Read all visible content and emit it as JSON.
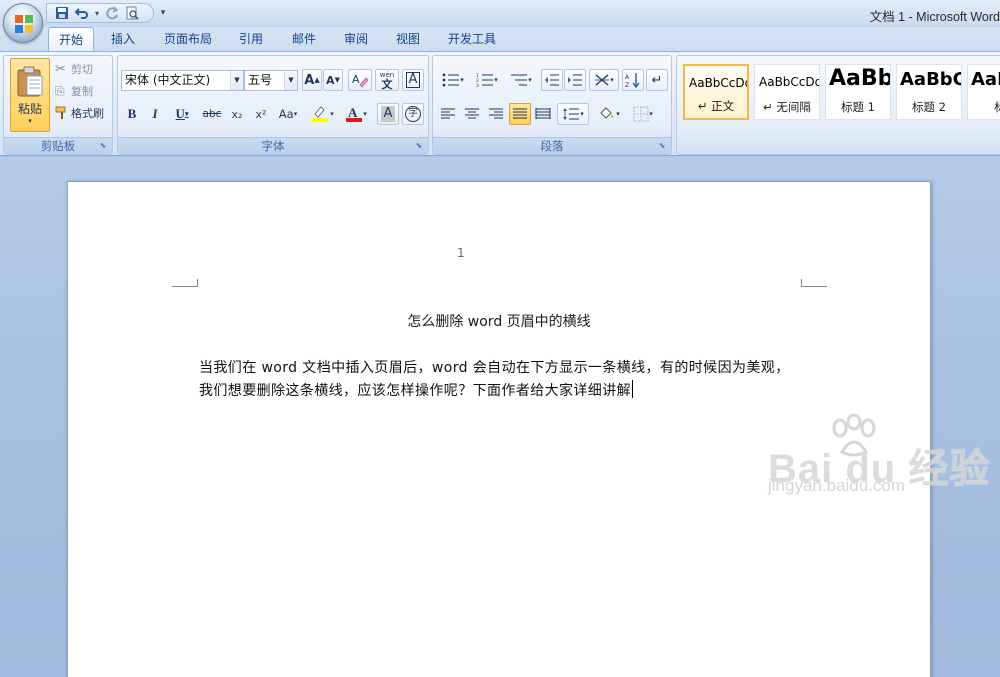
{
  "window": {
    "title": "文档 1 - Microsoft Word"
  },
  "qat": {
    "more": "▾"
  },
  "tabs": [
    {
      "label": "开始"
    },
    {
      "label": "插入"
    },
    {
      "label": "页面布局"
    },
    {
      "label": "引用"
    },
    {
      "label": "邮件"
    },
    {
      "label": "审阅"
    },
    {
      "label": "视图"
    },
    {
      "label": "开发工具"
    }
  ],
  "clipboard": {
    "label": "剪贴板",
    "paste": "粘贴",
    "cut": "剪切",
    "copy": "复制",
    "format_painter": "格式刷"
  },
  "font": {
    "label": "字体",
    "family": "宋体 (中文正文)",
    "size": "五号",
    "bold": "B",
    "italic": "I",
    "underline": "U",
    "strike": "abc",
    "subscript": "x₂",
    "superscript": "x²",
    "case": "Aa",
    "grow": "A",
    "shrink": "A",
    "clear": "A",
    "phonetic": "wén",
    "border_char": "A",
    "enclose": "字",
    "highlight_color": "#ffff00",
    "font_color": "#e01818"
  },
  "paragraph": {
    "label": "段落"
  },
  "styles": {
    "items": [
      {
        "sample": "AaBbCcDd",
        "name": "↵ 正文"
      },
      {
        "sample": "AaBbCcDd",
        "name": "↵ 无间隔"
      },
      {
        "sample": "AaBb",
        "name": "标题 1"
      },
      {
        "sample": "AaBbC",
        "name": "标题 2"
      },
      {
        "sample": "AaE",
        "name": "标"
      }
    ]
  },
  "document": {
    "page_number": "1",
    "title": "怎么删除 word 页眉中的横线",
    "body_line1": "当我们在 word 文档中插入页眉后，word 会自动在下方显示一条横线，有的时候因为美观，",
    "body_line2": "我们想要删除这条横线，应该怎样操作呢？下面作者给大家详细讲解"
  },
  "watermark": {
    "brand": "Bai du 经验",
    "url": "jingyan.baidu.com"
  }
}
